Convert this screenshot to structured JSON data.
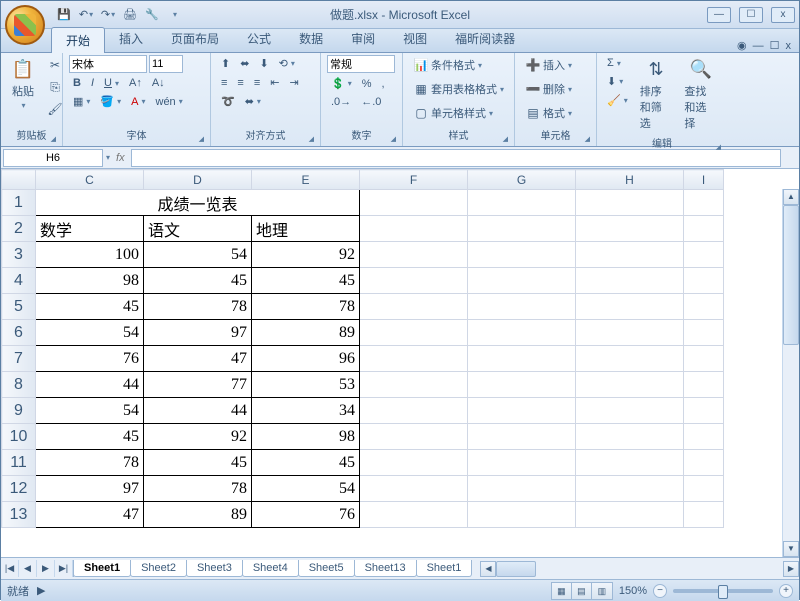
{
  "title": "做题.xlsx - Microsoft Excel",
  "qat_icons": [
    "save",
    "undo",
    "redo",
    "print",
    "tools"
  ],
  "win": {
    "min": "—",
    "max": "☐",
    "close": "x"
  },
  "tabs": [
    "开始",
    "插入",
    "页面布局",
    "公式",
    "数据",
    "审阅",
    "视图",
    "福昕阅读器"
  ],
  "active_tab": 0,
  "help_icon": "?",
  "ribbon": {
    "clipboard": {
      "paste": "粘贴",
      "label": "剪贴板"
    },
    "font": {
      "name": "宋体",
      "size": "11",
      "label": "字体"
    },
    "align": {
      "label": "对齐方式"
    },
    "number": {
      "format": "常规",
      "label": "数字"
    },
    "styles": {
      "cond": "条件格式",
      "table": "套用表格格式",
      "cell": "单元格样式",
      "label": "样式"
    },
    "cells": {
      "insert": "插入",
      "delete": "删除",
      "format": "格式",
      "label": "单元格"
    },
    "editing": {
      "sort": "排序和筛选",
      "find": "查找和选择",
      "label": "编辑"
    }
  },
  "namebox": "H6",
  "columns": [
    "C",
    "D",
    "E",
    "F",
    "G",
    "H",
    "I"
  ],
  "row_headers": [
    1,
    2,
    3,
    4,
    5,
    6,
    7,
    8,
    9,
    10,
    11,
    12,
    13
  ],
  "sheet": {
    "title_row": "成绩一览表",
    "headers": [
      "数学",
      "语文",
      "地理"
    ],
    "rows": [
      [
        100,
        54,
        92
      ],
      [
        98,
        45,
        45
      ],
      [
        45,
        78,
        78
      ],
      [
        54,
        97,
        89
      ],
      [
        76,
        47,
        96
      ],
      [
        44,
        77,
        53
      ],
      [
        54,
        44,
        34
      ],
      [
        45,
        92,
        98
      ],
      [
        78,
        45,
        45
      ],
      [
        97,
        78,
        54
      ],
      [
        47,
        89,
        76
      ]
    ]
  },
  "sheet_tabs": [
    "Sheet1",
    "Sheet2",
    "Sheet3",
    "Sheet4",
    "Sheet5",
    "Sheet13",
    "Sheet1"
  ],
  "active_sheet": 0,
  "status": "就绪",
  "zoom": "150%"
}
